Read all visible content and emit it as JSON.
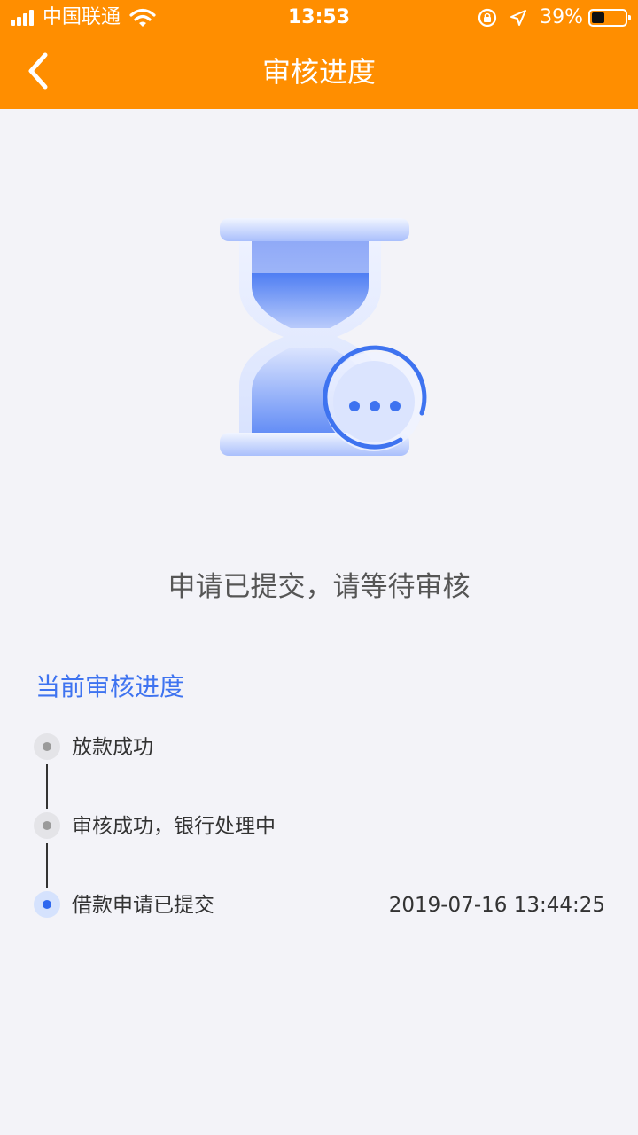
{
  "status_bar": {
    "carrier": "中国联通",
    "time": "13:53",
    "battery_percent": "39%",
    "battery_level": 0.39
  },
  "nav": {
    "back_icon": "chevron-left-icon",
    "title": "审核进度"
  },
  "illustration": {
    "icon": "hourglass-pending-icon"
  },
  "headline": "申请已提交，请等待审核",
  "progress": {
    "section_title": "当前审核进度",
    "steps": [
      {
        "label": "放款成功",
        "time": "",
        "state": "pending"
      },
      {
        "label": "审核成功，银行处理中",
        "time": "",
        "state": "pending"
      },
      {
        "label": "借款申请已提交",
        "time": "2019-07-16 13:44:25",
        "state": "current"
      }
    ]
  },
  "colors": {
    "header": "#ff8e00",
    "accent": "#3e73f0",
    "background": "#f3f3f8"
  }
}
